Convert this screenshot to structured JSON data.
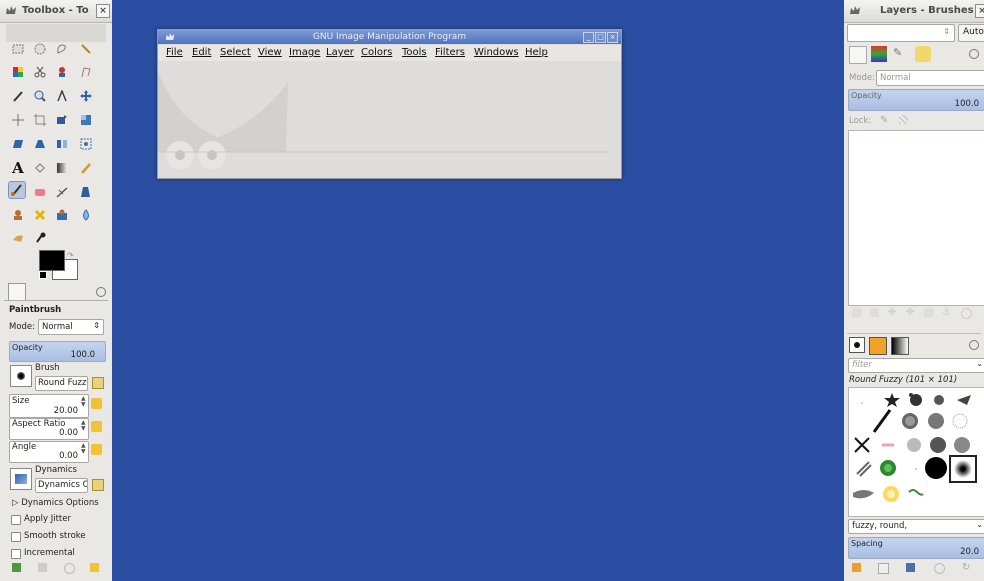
{
  "toolbox": {
    "title": "Toolbox - To",
    "close": "×",
    "tool_options_title": "Paintbrush",
    "mode_label": "Mode:",
    "mode_value": "Normal",
    "opacity_label": "Opacity",
    "opacity_value": "100.0",
    "brush_label": "Brush",
    "brush_value": "Round Fuzzy",
    "size_label": "Size",
    "size_value": "20.00",
    "aspect_label": "Aspect Ratio",
    "aspect_value": "0.00",
    "angle_label": "Angle",
    "angle_value": "0.00",
    "dynamics_label": "Dynamics",
    "dynamics_value": "Dynamics Of",
    "dynamics_options": "Dynamics Options",
    "apply_jitter": "Apply Jitter",
    "smooth_stroke": "Smooth stroke",
    "incremental": "Incremental"
  },
  "gimp": {
    "title": "GNU Image Manipulation Program",
    "menu": [
      "File",
      "Edit",
      "Select",
      "View",
      "Image",
      "Layer",
      "Colors",
      "Tools",
      "Filters",
      "Windows",
      "Help"
    ]
  },
  "layers": {
    "title": "Layers - Brushes",
    "auto": "Auto",
    "mode_label": "Mode:",
    "mode_value": "Normal",
    "opacity_label": "Opacity",
    "opacity_value": "100.0",
    "lock_label": "Lock:"
  },
  "brushes": {
    "filter_placeholder": "filter",
    "selected_brush": "Round Fuzzy (101 × 101)",
    "tags_value": "fuzzy, round,",
    "spacing_label": "Spacing",
    "spacing_value": "20.0"
  },
  "colors": {
    "desktop": "#2b4ea2",
    "fg": "#000000",
    "bg": "#ffffff"
  }
}
